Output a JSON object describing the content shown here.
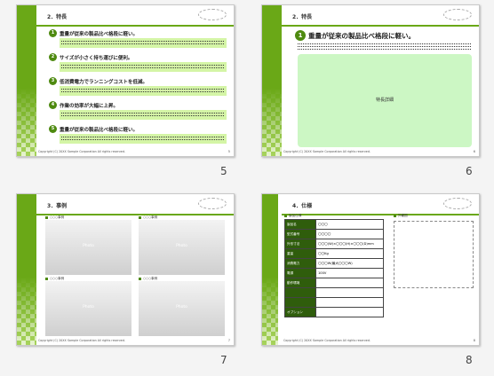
{
  "slides": [
    {
      "page_number": "5",
      "title": "2．特長",
      "copyright": "Copyright (C) 20XX Sample Corporation All rights reserved.",
      "footer_page": "5",
      "features": [
        {
          "num": "1",
          "label": "重量が従来の製品比べ格段に軽い。"
        },
        {
          "num": "2",
          "label": "サイズが小さく持ち運びに便利。"
        },
        {
          "num": "3",
          "label": "低消費電力でランニングコストを低減。"
        },
        {
          "num": "4",
          "label": "作業の効率が大幅に上昇。"
        },
        {
          "num": "5",
          "label": "重量が従来の製品比べ格段に軽い。"
        }
      ]
    },
    {
      "page_number": "6",
      "title": "2．特長",
      "copyright": "Copyright (C) 20XX Sample Corporation All rights reserved.",
      "footer_page": "6",
      "feature_num": "1",
      "feature_label": "重量が従来の製品比べ格段に軽い。",
      "panel_label": "特長詳細"
    },
    {
      "page_number": "7",
      "title": "3．事例",
      "copyright": "Copyright (C) 20XX Sample Corporation All rights reserved.",
      "footer_page": "7",
      "photos": [
        {
          "label": "○○○事例",
          "text": "Photo"
        },
        {
          "label": "○○○事例",
          "text": "Photo"
        },
        {
          "label": "○○○事例",
          "text": "Photo"
        },
        {
          "label": "○○○事例",
          "text": "Photo"
        }
      ]
    },
    {
      "page_number": "8",
      "title": "4．仕様",
      "copyright": "Copyright (C) 20XX Sample Corporation All rights reserved.",
      "footer_page": "8",
      "spec_heading": "製品仕様",
      "image_heading": "外観図",
      "specs": [
        {
          "key": "製品名",
          "value": "〇〇〇"
        },
        {
          "key": "型式番号",
          "value": "〇〇〇〇"
        },
        {
          "key": "外形寸法",
          "value": "〇〇〇(W)×〇〇〇(H)×〇〇〇(D)mm"
        },
        {
          "key": "重量",
          "value": "〇〇Kg"
        },
        {
          "key": "消費電力",
          "value": "〇〇〇W(最大〇〇〇W)"
        },
        {
          "key": "電源",
          "value": "100V"
        },
        {
          "key": "動作環境",
          "value": ""
        },
        {
          "key": "",
          "value": ""
        },
        {
          "key": "",
          "value": ""
        },
        {
          "key": "オプション",
          "value": ""
        }
      ]
    }
  ]
}
